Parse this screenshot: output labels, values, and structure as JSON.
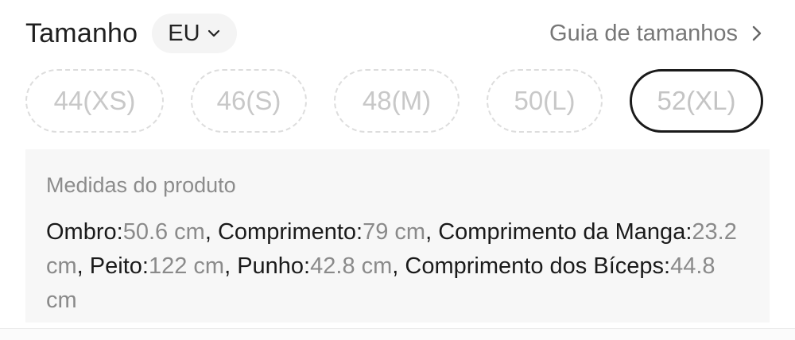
{
  "header": {
    "title": "Tamanho",
    "region": "EU",
    "guide_label": "Guia de tamanhos"
  },
  "sizes": [
    {
      "label": "44(XS)",
      "selected": false
    },
    {
      "label": "46(S)",
      "selected": false
    },
    {
      "label": "48(M)",
      "selected": false
    },
    {
      "label": "50(L)",
      "selected": false
    },
    {
      "label": "52(XL)",
      "selected": true
    }
  ],
  "measurements": {
    "title": "Medidas do produto",
    "items": [
      {
        "label": "Ombro:",
        "value": "50.6 cm",
        "sep": ", "
      },
      {
        "label": "Comprimento:",
        "value": "79 cm",
        "sep": ", "
      },
      {
        "label": "Comprimento da Manga:",
        "value": "23.2 cm",
        "sep": ", "
      },
      {
        "label": "Peito:",
        "value": "122 cm",
        "sep": ", "
      },
      {
        "label": "Punho:",
        "value": "42.8 cm",
        "sep": ", "
      },
      {
        "label": "Comprimento dos Bíceps:",
        "value": "44.8 cm",
        "sep": ""
      }
    ]
  }
}
